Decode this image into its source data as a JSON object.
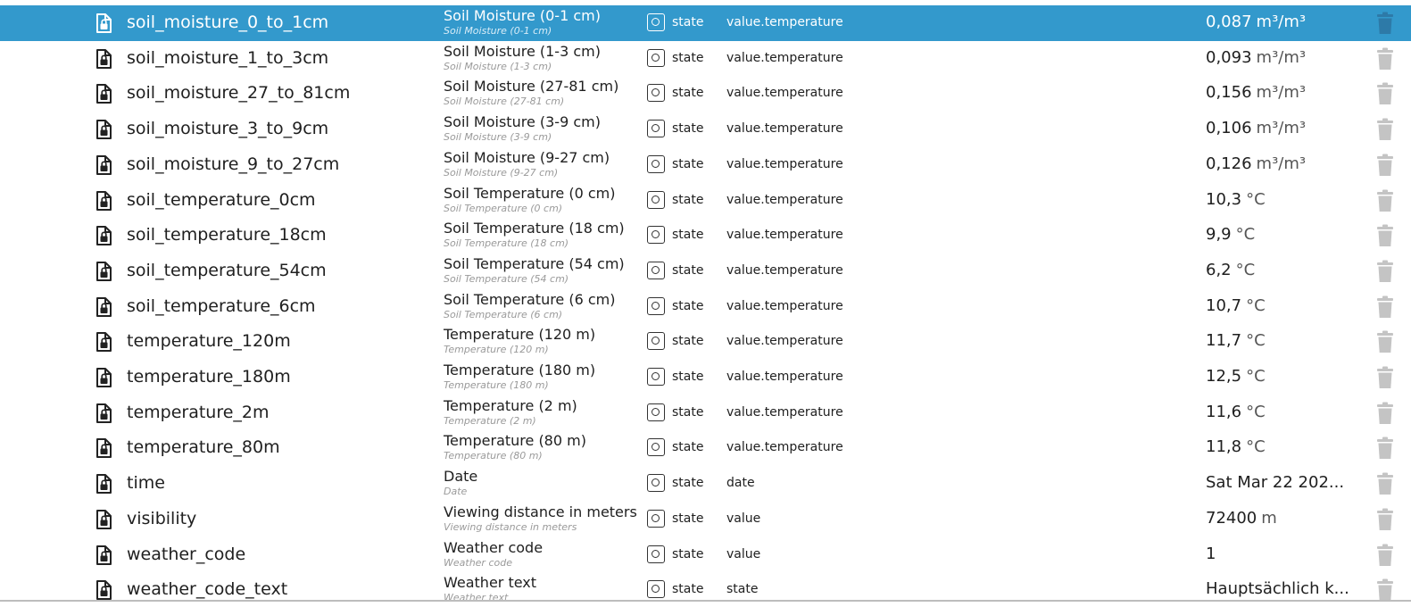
{
  "colors": {
    "selected_row": "#3399cc",
    "trash_icon": "#c4c4c4",
    "trash_icon_selected": "#2d7aa8"
  },
  "icons": {
    "object": "locked-file-icon",
    "type": "state-icon",
    "delete": "trash-icon"
  },
  "rows": [
    {
      "id": "soil_moisture_0_to_1cm",
      "name": "Soil Moisture (0-1 cm)",
      "subname": "Soil Moisture (0-1 cm)",
      "type": "state",
      "role": "value.temperature",
      "value": "0,087",
      "unit": "m³/m³",
      "selected": true
    },
    {
      "id": "soil_moisture_1_to_3cm",
      "name": "Soil Moisture (1-3 cm)",
      "subname": "Soil Moisture (1-3 cm)",
      "type": "state",
      "role": "value.temperature",
      "value": "0,093",
      "unit": "m³/m³"
    },
    {
      "id": "soil_moisture_27_to_81cm",
      "name": "Soil Moisture (27-81 cm)",
      "subname": "Soil Moisture (27-81 cm)",
      "type": "state",
      "role": "value.temperature",
      "value": "0,156",
      "unit": "m³/m³"
    },
    {
      "id": "soil_moisture_3_to_9cm",
      "name": "Soil Moisture (3-9 cm)",
      "subname": "Soil Moisture (3-9 cm)",
      "type": "state",
      "role": "value.temperature",
      "value": "0,106",
      "unit": "m³/m³"
    },
    {
      "id": "soil_moisture_9_to_27cm",
      "name": "Soil Moisture (9-27 cm)",
      "subname": "Soil Moisture (9-27 cm)",
      "type": "state",
      "role": "value.temperature",
      "value": "0,126",
      "unit": "m³/m³"
    },
    {
      "id": "soil_temperature_0cm",
      "name": "Soil Temperature (0 cm)",
      "subname": "Soil Temperature (0 cm)",
      "type": "state",
      "role": "value.temperature",
      "value": "10,3",
      "unit": "°C"
    },
    {
      "id": "soil_temperature_18cm",
      "name": "Soil Temperature (18 cm)",
      "subname": "Soil Temperature (18 cm)",
      "type": "state",
      "role": "value.temperature",
      "value": "9,9",
      "unit": "°C"
    },
    {
      "id": "soil_temperature_54cm",
      "name": "Soil Temperature (54 cm)",
      "subname": "Soil Temperature (54 cm)",
      "type": "state",
      "role": "value.temperature",
      "value": "6,2",
      "unit": "°C"
    },
    {
      "id": "soil_temperature_6cm",
      "name": "Soil Temperature (6 cm)",
      "subname": "Soil Temperature (6 cm)",
      "type": "state",
      "role": "value.temperature",
      "value": "10,7",
      "unit": "°C"
    },
    {
      "id": "temperature_120m",
      "name": "Temperature (120 m)",
      "subname": "Temperature (120 m)",
      "type": "state",
      "role": "value.temperature",
      "value": "11,7",
      "unit": "°C"
    },
    {
      "id": "temperature_180m",
      "name": "Temperature (180 m)",
      "subname": "Temperature (180 m)",
      "type": "state",
      "role": "value.temperature",
      "value": "12,5",
      "unit": "°C"
    },
    {
      "id": "temperature_2m",
      "name": "Temperature (2 m)",
      "subname": "Temperature (2 m)",
      "type": "state",
      "role": "value.temperature",
      "value": "11,6",
      "unit": "°C"
    },
    {
      "id": "temperature_80m",
      "name": "Temperature (80 m)",
      "subname": "Temperature (80 m)",
      "type": "state",
      "role": "value.temperature",
      "value": "11,8",
      "unit": "°C"
    },
    {
      "id": "time",
      "name": "Date",
      "subname": "Date",
      "type": "state",
      "role": "date",
      "value": "Sat Mar 22 202...",
      "unit": ""
    },
    {
      "id": "visibility",
      "name": "Viewing distance in meters",
      "subname": "Viewing distance in meters",
      "type": "state",
      "role": "value",
      "value": "72400",
      "unit": "m"
    },
    {
      "id": "weather_code",
      "name": "Weather code",
      "subname": "Weather code",
      "type": "state",
      "role": "value",
      "value": "1",
      "unit": ""
    },
    {
      "id": "weather_code_text",
      "name": "Weather text",
      "subname": "Weather text",
      "type": "state",
      "role": "state",
      "value": "Hauptsächlich k...",
      "unit": ""
    }
  ]
}
